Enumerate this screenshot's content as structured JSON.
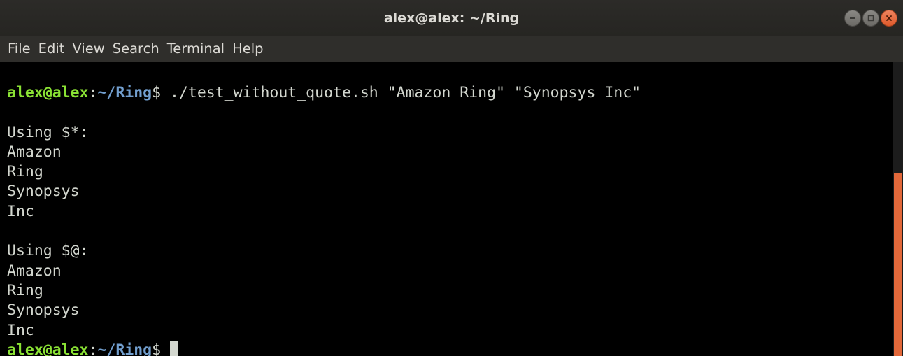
{
  "window": {
    "title": "alex@alex: ~/Ring"
  },
  "menu": {
    "items": [
      "File",
      "Edit",
      "View",
      "Search",
      "Terminal",
      "Help"
    ]
  },
  "prompt": {
    "user_host": "alex@alex",
    "colon": ":",
    "path": "~/Ring",
    "symbol": "$"
  },
  "command": " ./test_without_quote.sh \"Amazon Ring\" \"Synopsys Inc\"",
  "output": {
    "section1_header": "Using $*:",
    "section1_lines": [
      "Amazon",
      "Ring",
      "Synopsys",
      "Inc"
    ],
    "section2_header": "Using $@:",
    "section2_lines": [
      "Amazon",
      "Ring",
      "Synopsys",
      "Inc"
    ]
  },
  "colors": {
    "prompt_user": "#8ae234",
    "prompt_path": "#729fcf",
    "scroll_thumb": "#e2683a",
    "close_button": "#de5a2b"
  },
  "icons": {
    "minimize": "minimize-icon",
    "maximize": "maximize-icon",
    "close": "close-icon"
  }
}
